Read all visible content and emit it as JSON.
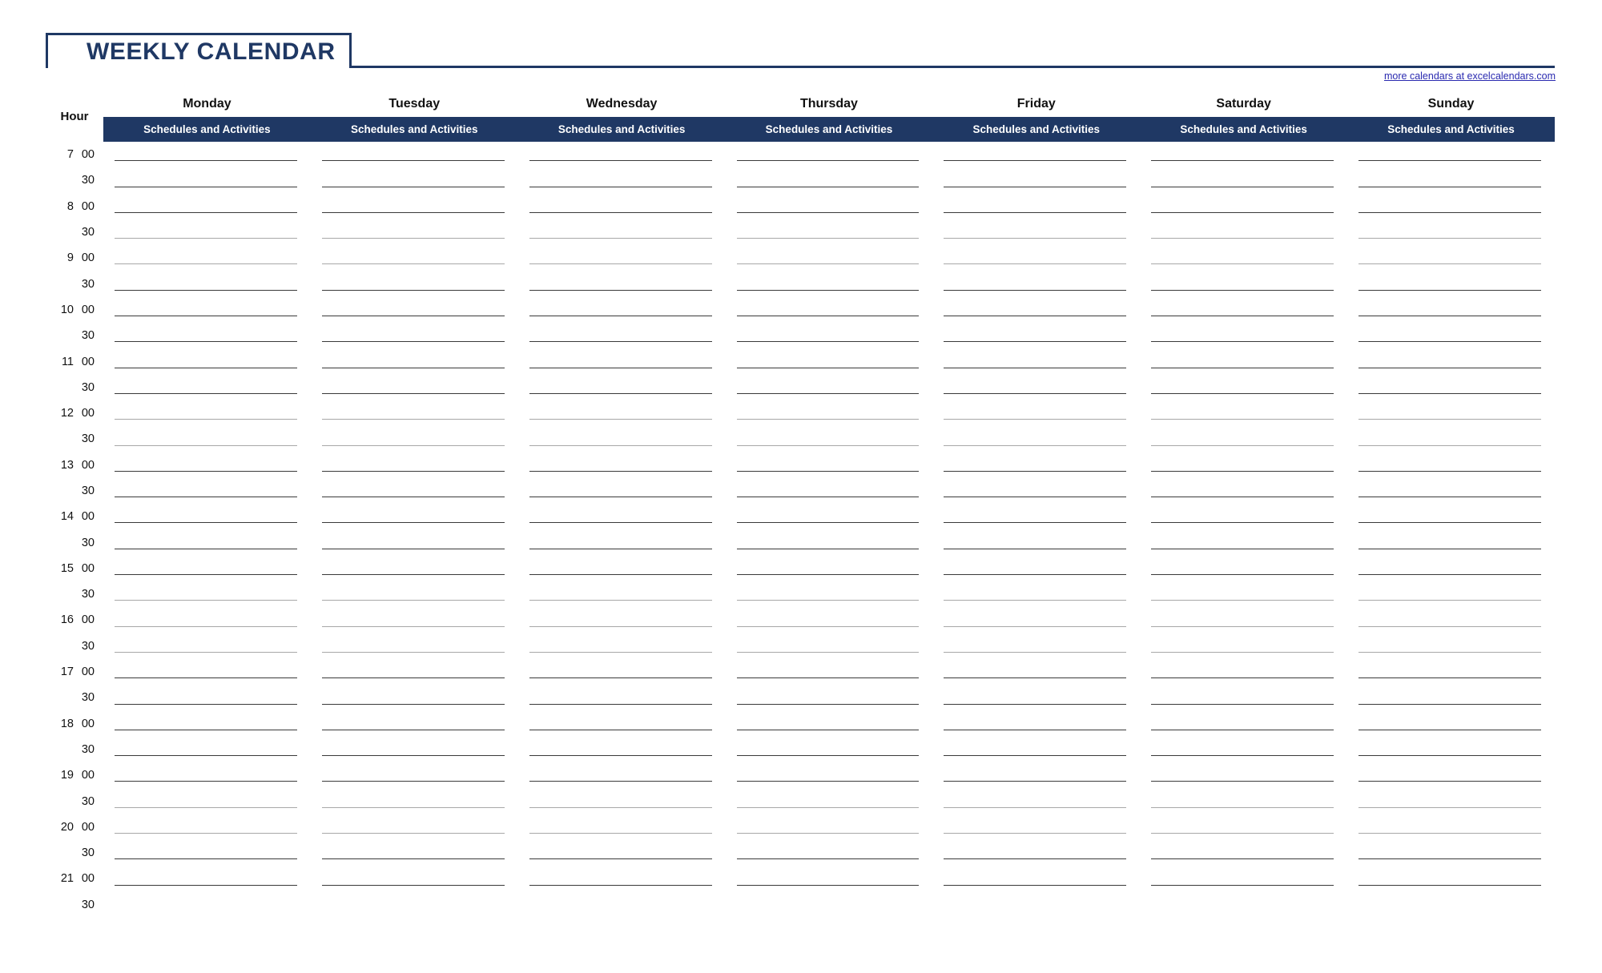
{
  "page": {
    "title": "WEEKLY CALENDAR",
    "credit_link": "more calendars at excelcalendars.com",
    "accent_color": "#1F3864",
    "link_color": "#2a2ab0",
    "grid_color": "#333333",
    "line_color": "#3a3a3a"
  },
  "table": {
    "hour_header": "Hour",
    "day_subheader": "Schedules and Activities",
    "days": [
      {
        "label": "Monday"
      },
      {
        "label": "Tuesday"
      },
      {
        "label": "Wednesday"
      },
      {
        "label": "Thursday"
      },
      {
        "label": "Friday"
      },
      {
        "label": "Saturday"
      },
      {
        "label": "Sunday"
      }
    ],
    "rows": [
      {
        "hour": "7",
        "minute": "00"
      },
      {
        "hour": "",
        "minute": "30"
      },
      {
        "hour": "8",
        "minute": "00"
      },
      {
        "hour": "",
        "minute": "30"
      },
      {
        "hour": "9",
        "minute": "00"
      },
      {
        "hour": "",
        "minute": "30"
      },
      {
        "hour": "10",
        "minute": "00"
      },
      {
        "hour": "",
        "minute": "30"
      },
      {
        "hour": "11",
        "minute": "00"
      },
      {
        "hour": "",
        "minute": "30"
      },
      {
        "hour": "12",
        "minute": "00"
      },
      {
        "hour": "",
        "minute": "30"
      },
      {
        "hour": "13",
        "minute": "00"
      },
      {
        "hour": "",
        "minute": "30"
      },
      {
        "hour": "14",
        "minute": "00"
      },
      {
        "hour": "",
        "minute": "30"
      },
      {
        "hour": "15",
        "minute": "00"
      },
      {
        "hour": "",
        "minute": "30"
      },
      {
        "hour": "16",
        "minute": "00"
      },
      {
        "hour": "",
        "minute": "30"
      },
      {
        "hour": "17",
        "minute": "00"
      },
      {
        "hour": "",
        "minute": "30"
      },
      {
        "hour": "18",
        "minute": "00"
      },
      {
        "hour": "",
        "minute": "30"
      },
      {
        "hour": "19",
        "minute": "00"
      },
      {
        "hour": "",
        "minute": "30"
      },
      {
        "hour": "20",
        "minute": "00"
      },
      {
        "hour": "",
        "minute": "30"
      },
      {
        "hour": "21",
        "minute": "00"
      },
      {
        "hour": "",
        "minute": "30"
      }
    ]
  }
}
